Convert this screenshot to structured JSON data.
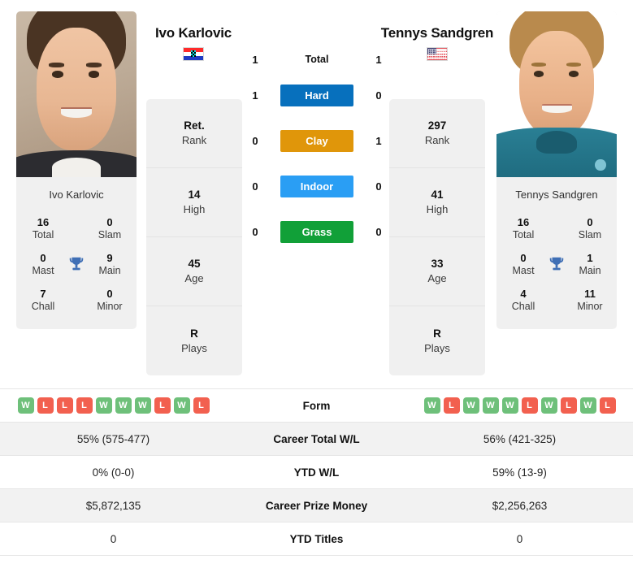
{
  "players": {
    "left": {
      "name": "Ivo Karlovic",
      "photo_name": "Ivo Karlovic",
      "country": "Croatia",
      "flag_icon": "flag-croatia-icon",
      "titles": [
        {
          "value": "16",
          "label": "Total"
        },
        {
          "value": "0",
          "label": "Slam"
        },
        {
          "value": "0",
          "label": "Mast"
        },
        {
          "value": "9",
          "label": "Main"
        },
        {
          "value": "7",
          "label": "Chall"
        },
        {
          "value": "0",
          "label": "Minor"
        }
      ],
      "stats": [
        {
          "value": "Ret.",
          "label": "Rank"
        },
        {
          "value": "14",
          "label": "High"
        },
        {
          "value": "45",
          "label": "Age"
        },
        {
          "value": "R",
          "label": "Plays"
        }
      ],
      "form": [
        "W",
        "L",
        "L",
        "L",
        "W",
        "W",
        "W",
        "L",
        "W",
        "L"
      ],
      "career_total_wl": "55% (575-477)",
      "ytd_wl": "0% (0-0)",
      "career_prize_money": "$5,872,135",
      "ytd_titles": "0"
    },
    "right": {
      "name": "Tennys Sandgren",
      "photo_name": "Tennys Sandgren",
      "country": "United States",
      "flag_icon": "flag-usa-icon",
      "titles": [
        {
          "value": "16",
          "label": "Total"
        },
        {
          "value": "0",
          "label": "Slam"
        },
        {
          "value": "0",
          "label": "Mast"
        },
        {
          "value": "1",
          "label": "Main"
        },
        {
          "value": "4",
          "label": "Chall"
        },
        {
          "value": "11",
          "label": "Minor"
        }
      ],
      "stats": [
        {
          "value": "297",
          "label": "Rank"
        },
        {
          "value": "41",
          "label": "High"
        },
        {
          "value": "33",
          "label": "Age"
        },
        {
          "value": "R",
          "label": "Plays"
        }
      ],
      "form": [
        "W",
        "L",
        "W",
        "W",
        "W",
        "L",
        "W",
        "L",
        "W",
        "L"
      ],
      "career_total_wl": "56% (421-325)",
      "ytd_wl": "59% (13-9)",
      "career_prize_money": "$2,256,263",
      "ytd_titles": "0"
    }
  },
  "head_to_head": {
    "total": {
      "left": "1",
      "label": "Total",
      "right": "1"
    },
    "surfaces": [
      {
        "left": "1",
        "label": "Hard",
        "right": "0",
        "color": "#0770bd"
      },
      {
        "left": "0",
        "label": "Clay",
        "right": "1",
        "color": "#e0960a"
      },
      {
        "left": "0",
        "label": "Indoor",
        "right": "0",
        "color": "#2a9ef4"
      },
      {
        "left": "0",
        "label": "Grass",
        "right": "0",
        "color": "#11a038"
      }
    ]
  },
  "comparison_rows": [
    {
      "label": "Form"
    },
    {
      "label": "Career Total W/L"
    },
    {
      "label": "YTD W/L"
    },
    {
      "label": "Career Prize Money"
    },
    {
      "label": "YTD Titles"
    }
  ],
  "colors": {
    "win_badge": "#6ec07a",
    "loss_badge": "#f2604f",
    "card_background": "#f0f0f0",
    "row_shaded": "#f2f2f2",
    "trophy": "#3f6fb5"
  }
}
